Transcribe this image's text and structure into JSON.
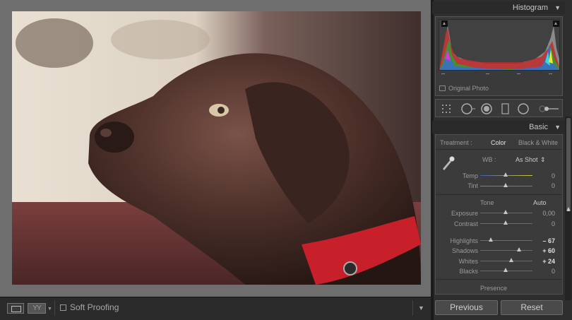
{
  "toolbar": {
    "compare_label": "YY",
    "soft_proofing_label": "Soft Proofing"
  },
  "histogram": {
    "title": "Histogram",
    "original_photo_label": "Original Photo"
  },
  "basic": {
    "title": "Basic",
    "treatment_label": "Treatment :",
    "treatment_color": "Color",
    "treatment_bw": "Black & White",
    "wb_label": "WB :",
    "wb_value": "As Shot",
    "temp": {
      "label": "Temp",
      "value": "0"
    },
    "tint": {
      "label": "Tint",
      "value": "0"
    },
    "tone_label": "Tone",
    "auto_label": "Auto",
    "exposure": {
      "label": "Exposure",
      "value": "0,00"
    },
    "contrast": {
      "label": "Contrast",
      "value": "0"
    },
    "highlights": {
      "label": "Highlights",
      "value": "– 67"
    },
    "shadows": {
      "label": "Shadows",
      "value": "+ 60"
    },
    "whites": {
      "label": "Whites",
      "value": "+ 24"
    },
    "blacks": {
      "label": "Blacks",
      "value": "0"
    },
    "presence_label": "Presence"
  },
  "buttons": {
    "previous": "Previous",
    "reset": "Reset"
  },
  "colors": {
    "temp_track_left": "#3b5fb0",
    "temp_track_right": "#d8c33a",
    "tint_track_left": "#3fae3f",
    "tint_track_right": "#b04cc0",
    "collar": "#c8202a"
  }
}
